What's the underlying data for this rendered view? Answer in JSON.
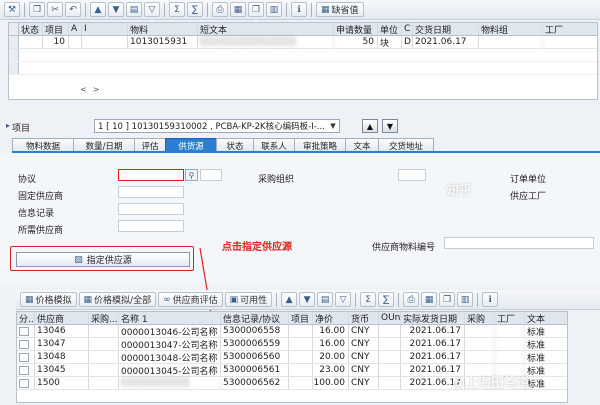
{
  "toolbar_top": {
    "buttons": [
      {
        "icon": "⚒"
      },
      {
        "icon": "❐"
      },
      {
        "icon": "✂"
      },
      {
        "icon": "↶"
      },
      {
        "icon": "▲"
      },
      {
        "icon": "▼"
      },
      {
        "icon": "▤"
      },
      {
        "icon": "▽"
      },
      {
        "icon": "Σ"
      },
      {
        "icon": "∑"
      },
      {
        "icon": "⎙"
      },
      {
        "icon": "▦"
      },
      {
        "icon": "❐"
      },
      {
        "icon": "▥"
      },
      {
        "icon": "ℹ"
      }
    ],
    "default_label": "缺省值"
  },
  "grid1": {
    "headers": [
      "状态",
      "项目",
      "A",
      "I",
      "物料",
      "短文本",
      "申请数量",
      "单位",
      "C",
      "交货日期",
      "物料组",
      "工厂"
    ],
    "row": {
      "item": "10",
      "material": "1013015931",
      "short_text": "░░░░░░░░░░░░░░",
      "qty": "50",
      "unit": "块",
      "c": "D",
      "date": "2021.06.17"
    },
    "scroll": [
      "<",
      ">"
    ]
  },
  "item_bar": {
    "label": "项目",
    "selected": "1 [ 10 ] 10130159310002 , PCBA-KP-2K核心编码板-I-...",
    "up": "▲",
    "down": "▼"
  },
  "tabs": [
    "物料数据",
    "数量/日期",
    "评估",
    "供货源",
    "状态",
    "联系人",
    "审批策略",
    "文本",
    "交货地址"
  ],
  "active_tab": "供货源",
  "form": {
    "agreement": "协议",
    "fixed_vendor": "固定供应商",
    "info_record": "信息记录",
    "desired_vendor": "所需供应商",
    "purch_org": "采购组织",
    "order_unit": "订单单位",
    "supplying_plant": "供应工厂",
    "vendor_mat_no": "供应商物料编号",
    "assign_button": "指定供应源",
    "annotation": "点击指定供应源"
  },
  "toolbar_bottom": {
    "btn_price_sim": "价格模拟",
    "btn_price_sim_all": "价格模拟/全部",
    "btn_vendor_eval": "供应商评估",
    "btn_availability": "可用性"
  },
  "grid2": {
    "headers": [
      "分...",
      "供应商",
      "采购...",
      "名称 1",
      "信息记录/协议",
      "项目",
      "净价",
      "货币",
      "OUn",
      "实际发货日期",
      "采购",
      "工厂",
      "文本"
    ],
    "rows": [
      {
        "vendor": "13046",
        "name": "0000013046-公司名称",
        "info": "5300006558",
        "price": "16.00",
        "cur": "CNY",
        "date": "2021.06.17",
        "text": "标准"
      },
      {
        "vendor": "13047",
        "name": "0000013047-公司名称",
        "info": "5300006559",
        "price": "16.00",
        "cur": "CNY",
        "date": "2021.06.17",
        "text": "标准"
      },
      {
        "vendor": "13048",
        "name": "0000013048-公司名称",
        "info": "5300006560",
        "price": "20.00",
        "cur": "CNY",
        "date": "2021.06.17",
        "text": "标准"
      },
      {
        "vendor": "13045",
        "name": "0000013045-公司名称",
        "info": "5300006561",
        "price": "23.00",
        "cur": "CNY",
        "date": "2021.06.17",
        "text": "标准"
      },
      {
        "vendor": "1500",
        "name": "░░░░░░░░░░",
        "info": "5300006562",
        "price": "100.00",
        "cur": "CNY",
        "date": "2021.06.17",
        "text": "标准"
      }
    ]
  },
  "watermarks": [
    "知乎",
    "@上海田笃道"
  ]
}
